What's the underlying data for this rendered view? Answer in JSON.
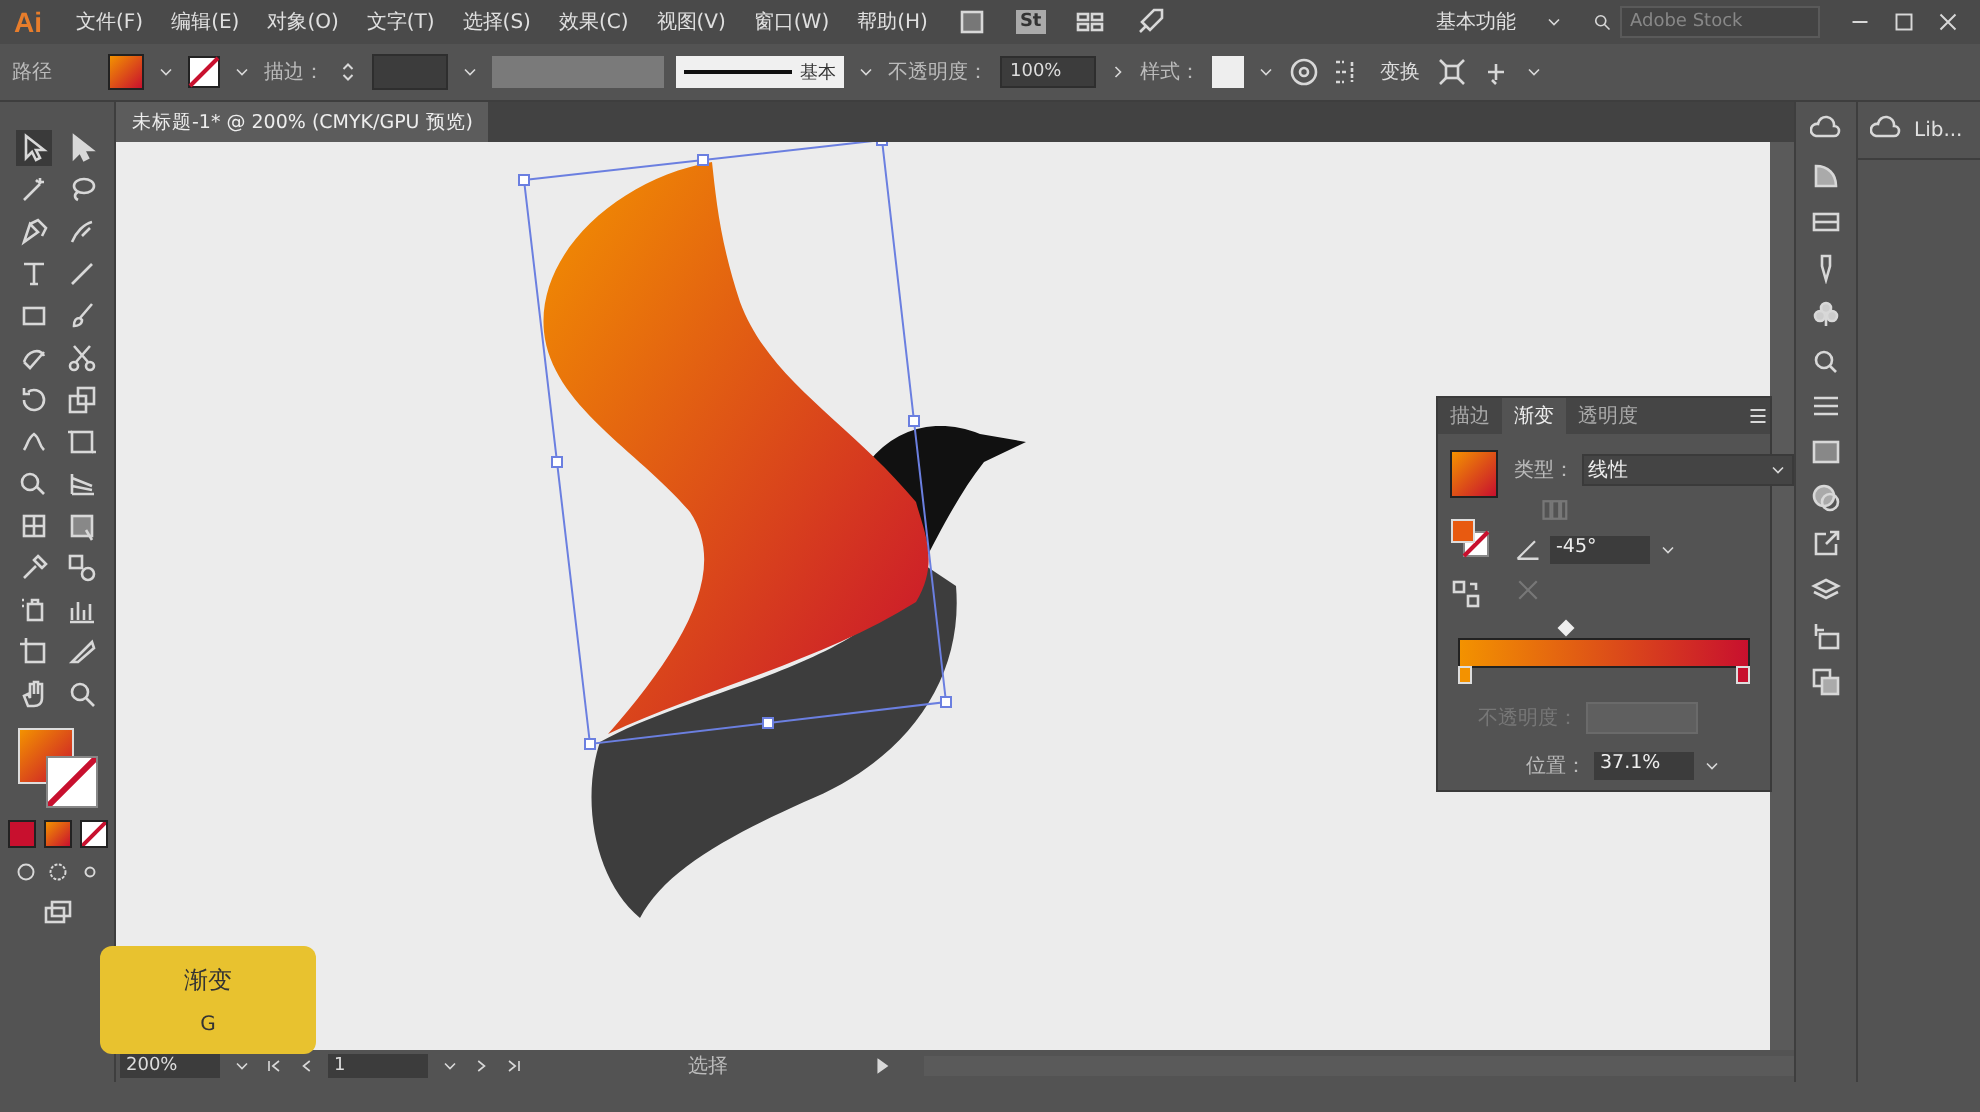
{
  "app": {
    "logo": "Ai"
  },
  "menu": [
    {
      "label": "文件(F)"
    },
    {
      "label": "编辑(E)"
    },
    {
      "label": "对象(O)"
    },
    {
      "label": "文字(T)"
    },
    {
      "label": "选择(S)"
    },
    {
      "label": "效果(C)"
    },
    {
      "label": "视图(V)"
    },
    {
      "label": "窗口(W)"
    },
    {
      "label": "帮助(H)"
    }
  ],
  "bridge_badge": "St",
  "workspace": "基本功能",
  "search": {
    "placeholder": "Adobe Stock"
  },
  "control_bar": {
    "selection": "路径",
    "stroke_label": "描边：",
    "stroke_profile": "基本",
    "opacity_label": "不透明度：",
    "opacity": "100%",
    "style_label": "样式：",
    "transform": "变换"
  },
  "document_tab": {
    "title": "未标题-1* @ 200% (CMYK/GPU 预览)",
    "selected": true
  },
  "gradient_panel": {
    "tabs": [
      {
        "label": "描边",
        "selected": false
      },
      {
        "label": "渐变",
        "selected": true
      },
      {
        "label": "透明度",
        "selected": false
      }
    ],
    "type_label": "类型：",
    "type": "线性",
    "angle": "-45°",
    "stops": [
      {
        "color": "#f39200"
      },
      {
        "color": "#c8102e"
      }
    ],
    "midpoint": {
      "level": 0.37
    },
    "opacity": {
      "label": "不透明度：",
      "disabled": true
    },
    "location_label": "位置：",
    "location": "37.1%"
  },
  "libraries": {
    "label": "Lib..."
  },
  "tooltip": {
    "title": "渐变",
    "shortcut": "G"
  },
  "status_bar": {
    "zoom": "200%",
    "artboard": "1",
    "tool": "选择"
  }
}
